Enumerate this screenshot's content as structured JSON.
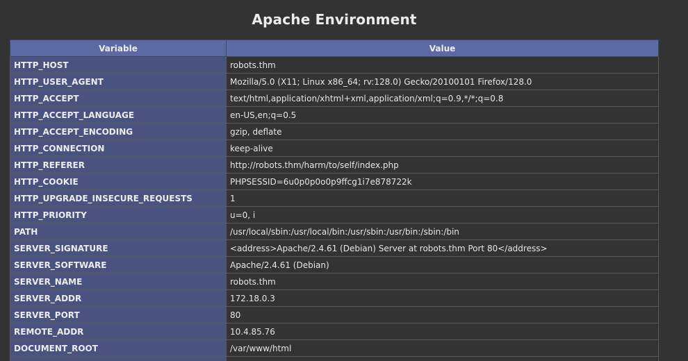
{
  "page": {
    "title": "Apache Environment"
  },
  "table": {
    "header_variable": "Variable",
    "header_value": "Value",
    "rows": [
      {
        "name": "HTTP_HOST",
        "value": "robots.thm"
      },
      {
        "name": "HTTP_USER_AGENT",
        "value": "Mozilla/5.0 (X11; Linux x86_64; rv:128.0) Gecko/20100101 Firefox/128.0"
      },
      {
        "name": "HTTP_ACCEPT",
        "value": "text/html,application/xhtml+xml,application/xml;q=0.9,*/*;q=0.8"
      },
      {
        "name": "HTTP_ACCEPT_LANGUAGE",
        "value": "en-US,en;q=0.5"
      },
      {
        "name": "HTTP_ACCEPT_ENCODING",
        "value": "gzip, deflate"
      },
      {
        "name": "HTTP_CONNECTION",
        "value": "keep-alive"
      },
      {
        "name": "HTTP_REFERER",
        "value": "http://robots.thm/harm/to/self/index.php"
      },
      {
        "name": "HTTP_COOKIE",
        "value": "PHPSESSID=6u0p0p0o0p9ffcg1i7e878722k"
      },
      {
        "name": "HTTP_UPGRADE_INSECURE_REQUESTS",
        "value": "1"
      },
      {
        "name": "HTTP_PRIORITY",
        "value": "u=0, i"
      },
      {
        "name": "PATH",
        "value": "/usr/local/sbin:/usr/local/bin:/usr/sbin:/usr/bin:/sbin:/bin"
      },
      {
        "name": "SERVER_SIGNATURE",
        "value": "<address>Apache/2.4.61 (Debian) Server at robots.thm Port 80</address>"
      },
      {
        "name": "SERVER_SOFTWARE",
        "value": "Apache/2.4.61 (Debian)"
      },
      {
        "name": "SERVER_NAME",
        "value": "robots.thm"
      },
      {
        "name": "SERVER_ADDR",
        "value": "172.18.0.3"
      },
      {
        "name": "SERVER_PORT",
        "value": "80"
      },
      {
        "name": "REMOTE_ADDR",
        "value": "10.4.85.76"
      },
      {
        "name": "DOCUMENT_ROOT",
        "value": "/var/www/html"
      },
      {
        "name": "",
        "value": ""
      }
    ]
  }
}
